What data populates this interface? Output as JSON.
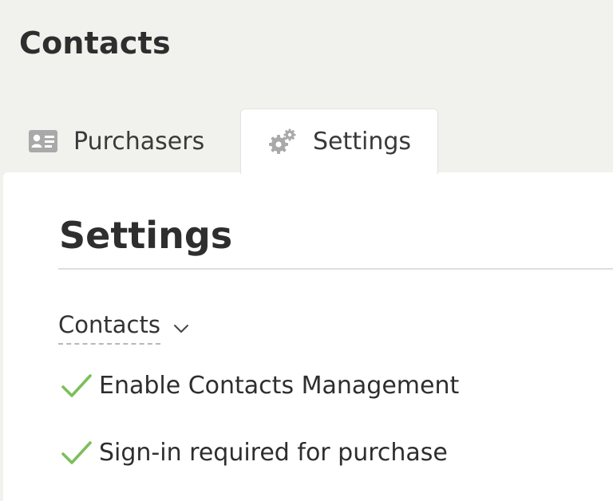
{
  "page": {
    "title": "Contacts"
  },
  "tabs": [
    {
      "label": "Purchasers",
      "icon": "contact-card-icon",
      "active": false
    },
    {
      "label": "Settings",
      "icon": "gears-icon",
      "active": true
    }
  ],
  "panel": {
    "title": "Settings",
    "dropdown": {
      "label": "Contacts",
      "icon": "chevron-down-icon"
    },
    "options": [
      {
        "label": "Enable Contacts Management",
        "checked": true
      },
      {
        "label": "Sign-in required for purchase",
        "checked": true
      }
    ]
  },
  "colors": {
    "background": "#f1f1ee",
    "panel": "#ffffff",
    "check": "#7cbf5a",
    "icon": "#a9a9a9"
  }
}
